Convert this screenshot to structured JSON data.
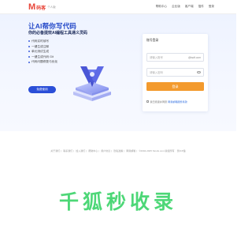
{
  "header": {
    "logo_mark": "M",
    "logo_text": "码客",
    "logo_sub": "个人版",
    "nav": [
      "帮助中心",
      "企业版",
      "客户端",
      "插件",
      "登录"
    ]
  },
  "hero": {
    "title": "让AI帮你写代码",
    "subtitle": "你的必备提效AI编程工具通义灵码",
    "features": [
      "代码实时续写",
      "一键生成注释",
      "单元测试生成",
      "一键生成代码 Git",
      "代码问题修复与优化"
    ],
    "cta": "免费使用"
  },
  "login": {
    "title": "账号登录",
    "username_placeholder": "请输入账号",
    "username_suffix": "@isoft.com",
    "password_placeholder": "请输入密码",
    "login_button": "登录",
    "agree_text": "我已阅读并同意",
    "agree_link": "网易邮箱服务条款"
  },
  "footer": {
    "links": [
      "关于我们",
      "联系我们",
      "加入我们",
      "帮助中心",
      "用户协议",
      "隐私政策",
      "网易邮箱",
      "©2004-2025 Sinofu.com 版权所有",
      "浙ICP备"
    ]
  },
  "watermark": "千狐秒收录",
  "colors": {
    "accent_blue": "#2b4fd8",
    "login_orange": "#f39a2d",
    "brand_red": "#e8463a",
    "watermark_green": "#2fd160"
  }
}
